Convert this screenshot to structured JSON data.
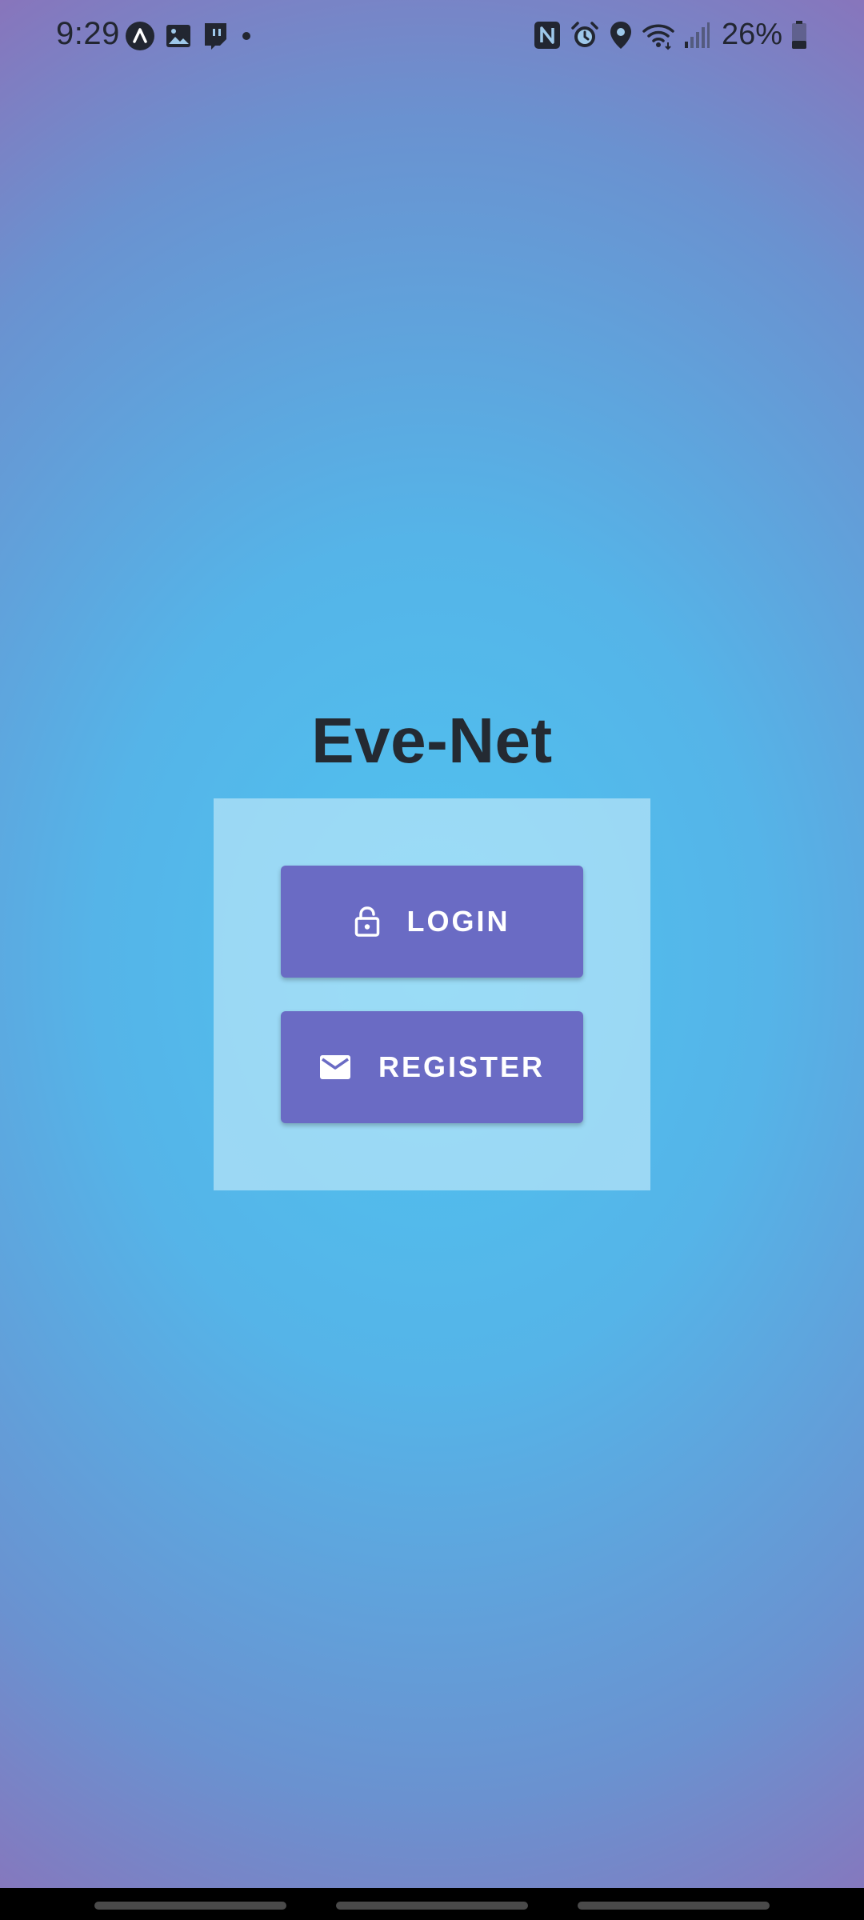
{
  "status_bar": {
    "time": "9:29",
    "battery": "26%",
    "left_icons": [
      "assistant-icon",
      "gallery-icon",
      "twitch-icon",
      "notification-dot-icon"
    ],
    "right_icons": [
      "nfc-icon",
      "alarm-icon",
      "location-icon",
      "wifi-icon",
      "signal-icon",
      "battery-icon"
    ]
  },
  "app": {
    "title": "Eve-Net"
  },
  "buttons": {
    "login_label": "LOGIN",
    "login_icon": "lock-icon",
    "register_label": "REGISTER",
    "register_icon": "mail-icon"
  },
  "colors": {
    "button": "#6a6bc4",
    "title": "#242a32",
    "card": "#c8ecfa"
  }
}
